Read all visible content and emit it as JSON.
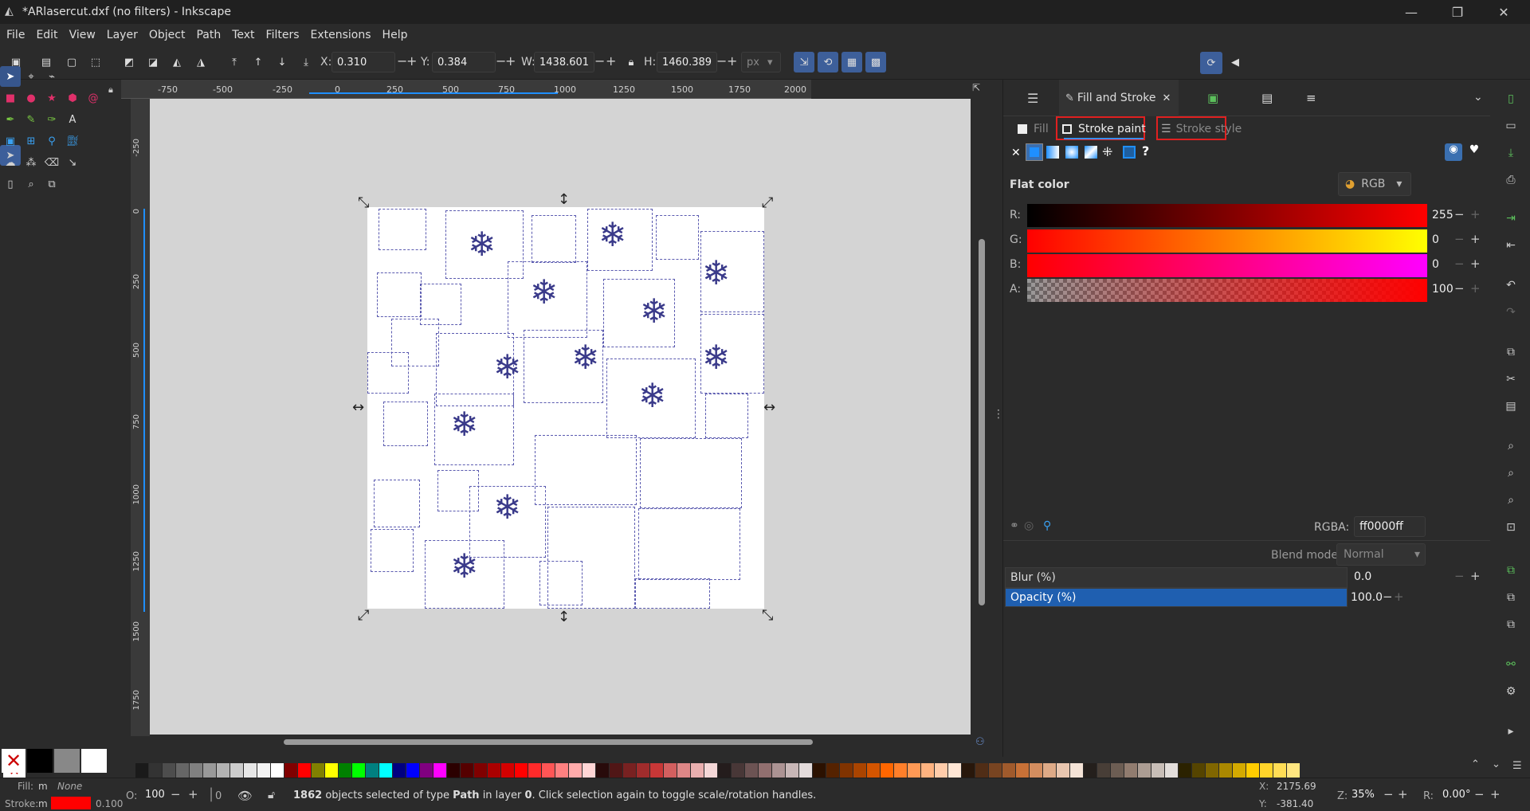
{
  "window": {
    "title": "*ARlasercut.dxf (no filters) - Inkscape",
    "minimize_icon": "minimize-icon",
    "maximize_icon": "maximize-icon",
    "close_icon": "close-icon"
  },
  "menu": [
    "File",
    "Edit",
    "View",
    "Layer",
    "Object",
    "Path",
    "Text",
    "Filters",
    "Extensions",
    "Help"
  ],
  "toolbar": {
    "x_label": "X:",
    "x_value": "0.310",
    "y_label": "Y:",
    "y_value": "0.384",
    "w_label": "W:",
    "w_value": "1438.601",
    "h_label": "H:",
    "h_value": "1460.389",
    "unit": "px"
  },
  "ruler": {
    "h_ticks": [
      "-750",
      "-500",
      "-250",
      "0",
      "250",
      "500",
      "750",
      "1000",
      "1250",
      "1500",
      "1750",
      "2000"
    ],
    "v_ticks": [
      "-250",
      "0",
      "250",
      "500",
      "750",
      "1000",
      "1250",
      "1500",
      "1750"
    ]
  },
  "panel": {
    "tab_title": "Fill and Stroke",
    "subtabs": {
      "fill": "Fill",
      "stroke_paint": "Stroke paint",
      "stroke_style": "Stroke style"
    },
    "flat_color": "Flat color",
    "color_mode": "RGB",
    "r_label": "R:",
    "r_value": "255",
    "g_label": "G:",
    "g_value": "0",
    "b_label": "B:",
    "b_value": "0",
    "a_label": "A:",
    "a_value": "100",
    "rgba_label": "RGBA:",
    "rgba_value": "ff0000ff",
    "blend_label": "Blend mode:",
    "blend_value": "Normal",
    "blur_label": "Blur (%)",
    "blur_value": "0.0",
    "opacity_label": "Opacity (%)",
    "opacity_value": "100.0",
    "help": "?",
    "none_x": "✕"
  },
  "status": {
    "fill_label": "Fill:",
    "fill_m": "m",
    "fill_value": "None",
    "stroke_label": "Stroke:",
    "stroke_m": "m",
    "stroke_width": "0.100",
    "o_label": "O:",
    "o_value": "100",
    "layer": "0",
    "msg_count": "1862",
    "msg_part1": " objects selected of type ",
    "msg_type": "Path",
    "msg_part2": " in layer ",
    "msg_layer": "0",
    "msg_part3": ". Click selection again to toggle scale/rotation handles.",
    "cx_label": "X:",
    "cx_value": "2175.69",
    "cy_label": "Y:",
    "cy_value": "-381.40",
    "zoom_label": "Z:",
    "zoom_value": "35%",
    "rot_label": "R:",
    "rot_value": "0.00°"
  },
  "colors": {
    "accent": "#1f6fd0",
    "stroke": "#ff0000"
  }
}
